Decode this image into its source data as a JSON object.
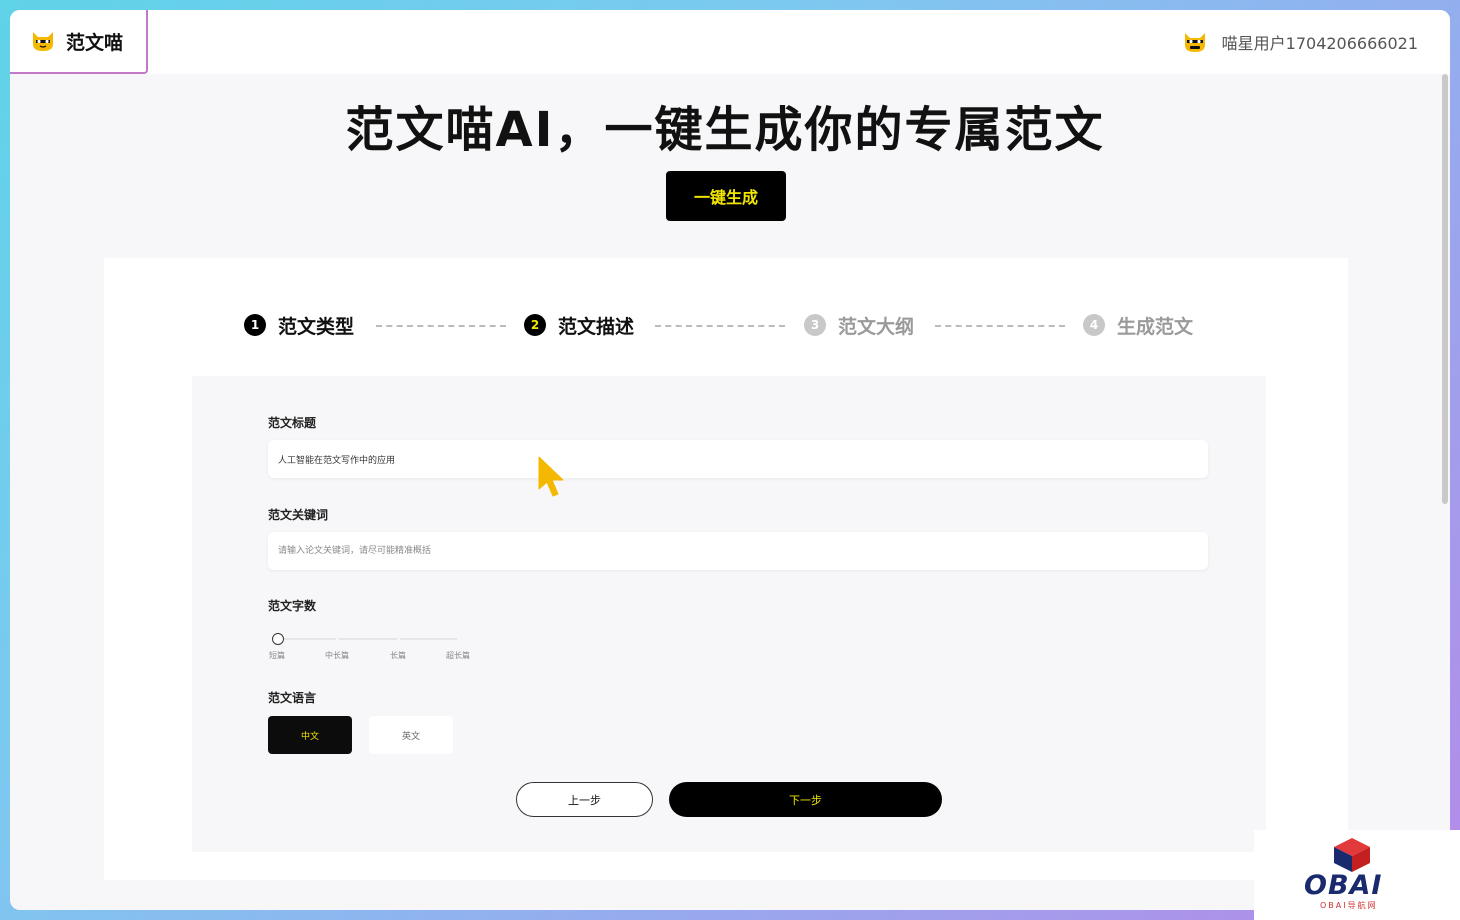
{
  "header": {
    "brand_name": "范文喵",
    "brand_icon": "cat-icon",
    "user_avatar": "cat-avatar-icon",
    "user_name": "喵星用户1704206666021"
  },
  "hero": {
    "title": "范文喵AI，一键生成你的专属范文",
    "generate_button": "一键生成"
  },
  "steps": [
    {
      "num": "1",
      "label": "范文类型",
      "state": "done"
    },
    {
      "num": "2",
      "label": "范文描述",
      "state": "current"
    },
    {
      "num": "3",
      "label": "范文大纲",
      "state": "pending"
    },
    {
      "num": "4",
      "label": "生成范文",
      "state": "pending"
    }
  ],
  "form": {
    "title_label": "范文标题",
    "title_value": "人工智能在范文写作中的应用",
    "keywords_label": "范文关键词",
    "keywords_placeholder": "请输入论文关键词，请尽可能精准概括",
    "length_label": "范文字数",
    "length_options": [
      "短篇",
      "中长篇",
      "长篇",
      "超长篇"
    ],
    "length_selected": "短篇",
    "language_label": "范文语言",
    "language_options": [
      "中文",
      "英文"
    ],
    "language_selected": "中文",
    "prev_button": "上一步",
    "next_button": "下一步"
  },
  "watermark": {
    "logo_text": "OBAI",
    "sub_text": "OBAI导航网"
  },
  "colors": {
    "accent_yellow": "#f2e600",
    "primary_black": "#000000",
    "brand_border": "#c478c8",
    "cursor": "#f5b800"
  }
}
